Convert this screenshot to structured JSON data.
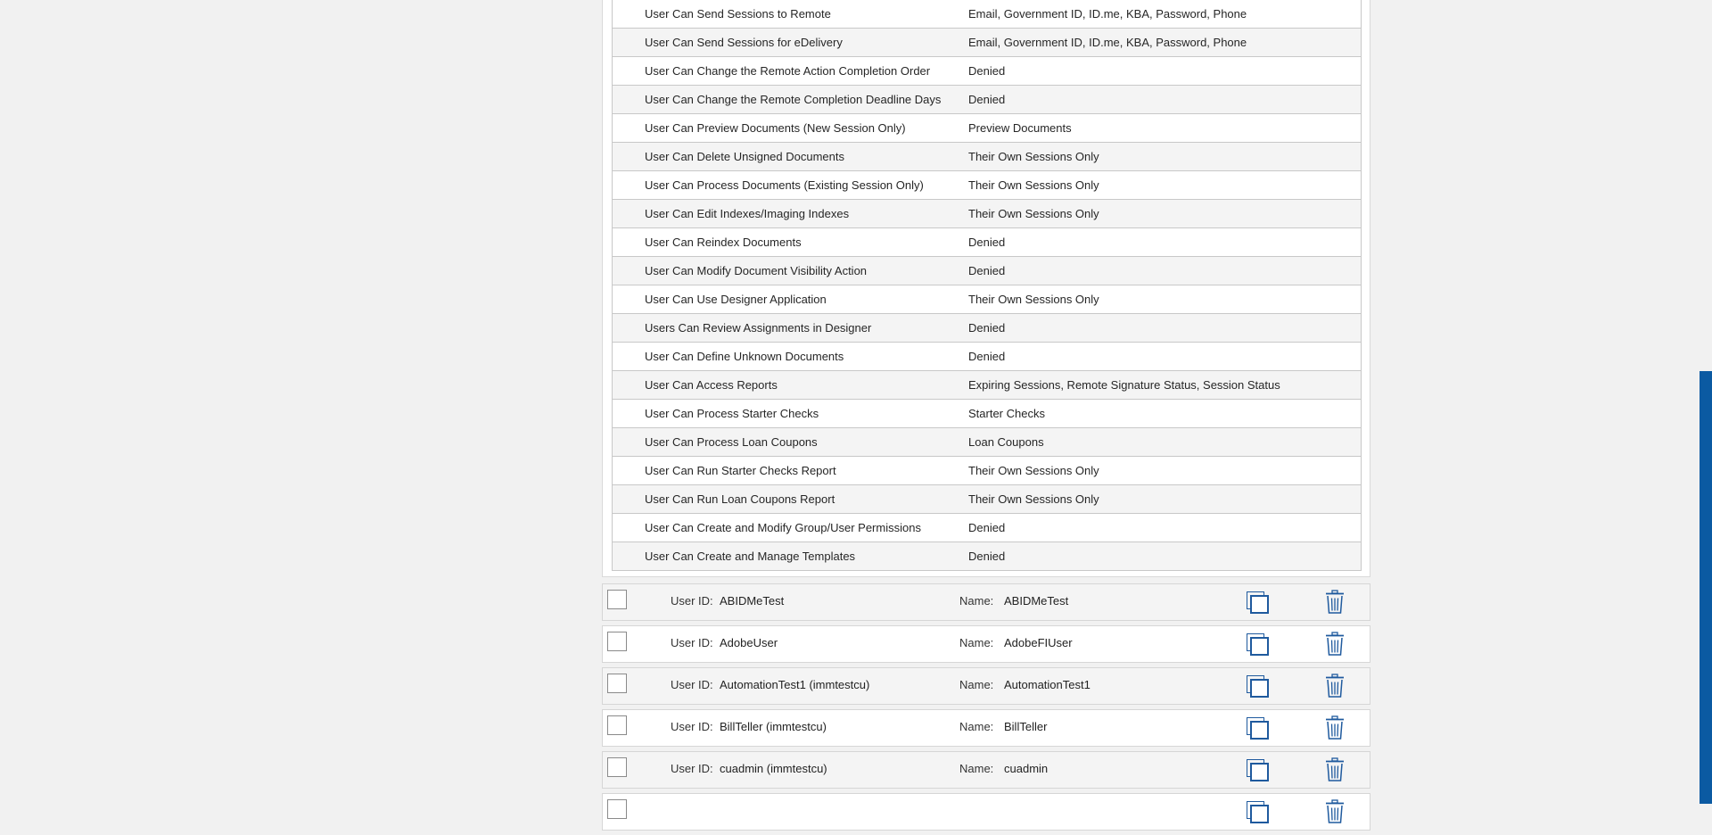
{
  "permissions": [
    {
      "name": "User Can Send Sessions to Remote",
      "value": "Email, Government ID, ID.me, KBA, Password, Phone"
    },
    {
      "name": "User Can Send Sessions for eDelivery",
      "value": "Email, Government ID, ID.me, KBA, Password, Phone"
    },
    {
      "name": "User Can Change the Remote Action Completion Order",
      "value": "Denied"
    },
    {
      "name": "User Can Change the Remote Completion Deadline Days",
      "value": "Denied"
    },
    {
      "name": "User Can Preview Documents (New Session Only)",
      "value": "Preview Documents"
    },
    {
      "name": "User Can Delete Unsigned Documents",
      "value": "Their Own Sessions Only"
    },
    {
      "name": "User Can Process Documents (Existing Session Only)",
      "value": "Their Own Sessions Only"
    },
    {
      "name": "User Can Edit Indexes/Imaging Indexes",
      "value": "Their Own Sessions Only"
    },
    {
      "name": "User Can Reindex Documents",
      "value": "Denied"
    },
    {
      "name": "User Can Modify Document Visibility Action",
      "value": "Denied"
    },
    {
      "name": "User Can Use Designer Application",
      "value": "Their Own Sessions Only"
    },
    {
      "name": "Users Can Review Assignments in Designer",
      "value": "Denied"
    },
    {
      "name": "User Can Define Unknown Documents",
      "value": "Denied"
    },
    {
      "name": "User Can Access Reports",
      "value": "Expiring Sessions, Remote Signature Status, Session Status"
    },
    {
      "name": "User Can Process Starter Checks",
      "value": "Starter Checks"
    },
    {
      "name": "User Can Process Loan Coupons",
      "value": "Loan Coupons"
    },
    {
      "name": "User Can Run Starter Checks Report",
      "value": "Their Own Sessions Only"
    },
    {
      "name": "User Can Run Loan Coupons Report",
      "value": "Their Own Sessions Only"
    },
    {
      "name": "User Can Create and Modify Group/User Permissions",
      "value": "Denied"
    },
    {
      "name": "User Can Create and Manage Templates",
      "value": "Denied"
    }
  ],
  "labels": {
    "user_id": "User ID:",
    "name": "Name:"
  },
  "users": [
    {
      "user_id": "ABIDMeTest",
      "name": "ABIDMeTest"
    },
    {
      "user_id": "AdobeUser",
      "name": "AdobeFIUser"
    },
    {
      "user_id": "AutomationTest1 (immtestcu)",
      "name": "AutomationTest1"
    },
    {
      "user_id": "BillTeller (immtestcu)",
      "name": "BillTeller"
    },
    {
      "user_id": "cuadmin (immtestcu)",
      "name": "cuadmin"
    },
    {
      "user_id": "",
      "name": ""
    }
  ],
  "icons": {
    "copy": "copy-icon",
    "delete": "trash-icon"
  },
  "colors": {
    "accent": "#1f5a9e",
    "scroll_accent": "#0b5aa2",
    "row_alt": "#f4f4f4"
  }
}
